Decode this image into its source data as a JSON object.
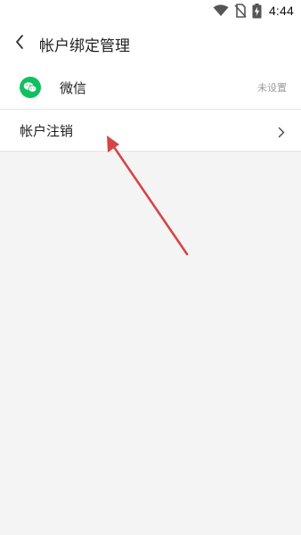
{
  "status_bar": {
    "time": "4:44",
    "icons": [
      "wifi-icon",
      "no-sim-icon",
      "battery-charging-icon"
    ]
  },
  "header": {
    "title": "帐户绑定管理",
    "back_icon": "back-chevron-icon"
  },
  "rows": [
    {
      "label": "微信",
      "icon": "wechat-icon",
      "status": "未设置"
    },
    {
      "label": "帐户注销",
      "icon": "chevron-right-icon"
    }
  ],
  "colors": {
    "wechat_green": "#0fc15e",
    "annotation_arrow": "#d64545",
    "background": "#f4f4f4"
  }
}
